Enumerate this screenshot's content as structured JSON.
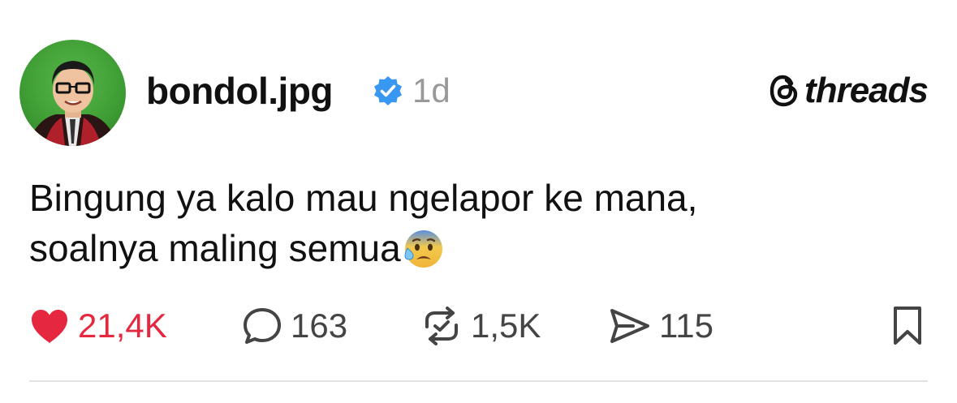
{
  "post": {
    "username": "bondol.jpg",
    "time": "1d",
    "text_line1": "Bingung ya kalo mau ngelapor ke mana,",
    "text_line2": "soalnya maling semua",
    "emoji_icon": "anxious-face-with-sweat-icon"
  },
  "brand": {
    "name": "threads"
  },
  "actions": {
    "likes": "21,4K",
    "replies": "163",
    "reposts": "1,5K",
    "shares": "115"
  },
  "colors": {
    "like": "#e5283f",
    "verified": "#3897f0",
    "muted": "#999999",
    "avatar_bg": "#46a83c"
  }
}
